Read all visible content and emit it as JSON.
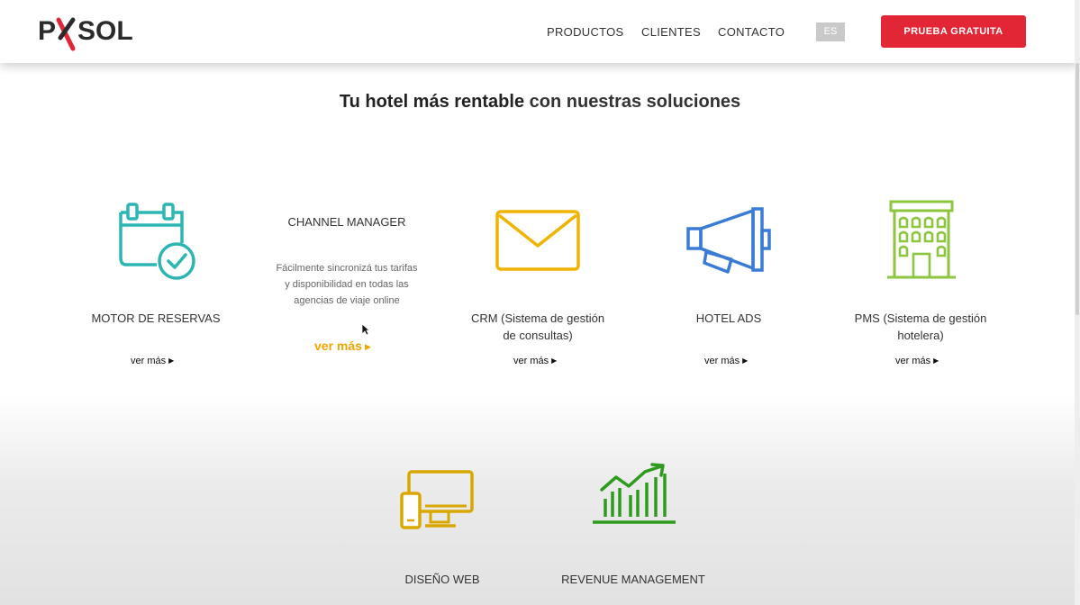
{
  "brand": {
    "logo_p": "P",
    "logo_x": "X",
    "logo_rest": "SOL"
  },
  "nav": {
    "items": [
      "PRODUCTOS",
      "CLIENTES",
      "CONTACTO"
    ],
    "lang": "ES",
    "cta": "PRUEBA GRATUITA"
  },
  "headline": {
    "bold": "Tu hotel más rentable",
    "rest": "con nuestras soluciones"
  },
  "products": [
    {
      "title": "MOTOR DE RESERVAS",
      "more": "ver más",
      "icon": "calendar-check-icon",
      "color": "#2cb5b3"
    },
    {
      "title": "CHANNEL MANAGER",
      "desc": "Fácilmente sincronizá tus tarifas y disponibilidad en todas las agencias de viaje online",
      "more": "ver más",
      "icon": "none",
      "color": "#f0a500"
    },
    {
      "title_line1": "CRM (Sistema de gestión",
      "title_line2": "de consultas)",
      "more": "ver más",
      "icon": "envelope-icon",
      "color": "#f0b400"
    },
    {
      "title": "HOTEL ADS",
      "more": "ver más",
      "icon": "megaphone-icon",
      "color": "#3a7bd5"
    },
    {
      "title_line1": "PMS (Sistema de gestión",
      "title_line2": "hotelera)",
      "more": "ver más",
      "icon": "building-icon",
      "color": "#8cc63f"
    },
    {
      "title": "DISEÑO WEB",
      "icon": "devices-icon",
      "color": "#d9a800"
    },
    {
      "title": "REVENUE MANAGEMENT",
      "icon": "growth-chart-icon",
      "color": "#2e9a1e"
    }
  ],
  "colors": {
    "brand_red": "#e32636",
    "accent_orange": "#f0a500"
  }
}
